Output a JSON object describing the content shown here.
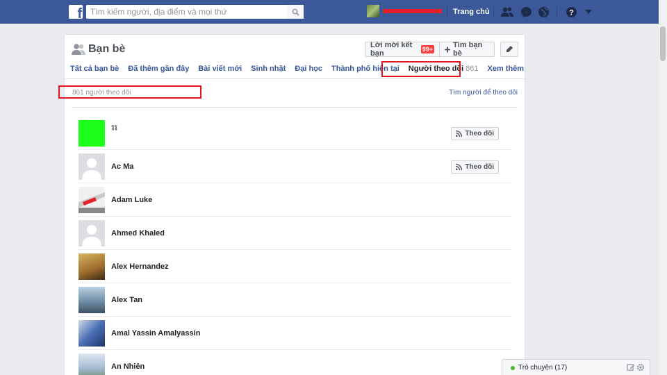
{
  "topbar": {
    "search_placeholder": "Tìm kiếm người, địa điểm và mọi thứ",
    "home_label": "Trang chủ",
    "icons": [
      "friend-requests-icon",
      "messenger-icon",
      "notifications-globe-icon",
      "help-icon",
      "dropdown-arrow-icon"
    ],
    "brand_color": "#3b5998"
  },
  "panel": {
    "title": "Bạn bè",
    "friend_requests_label": "Lời mời kết bạn",
    "friend_requests_badge": "99+",
    "find_friends_label": "Tìm bạn bè",
    "tabs": [
      {
        "label": "Tất cả bạn bè"
      },
      {
        "label": "Đã thêm gần đây"
      },
      {
        "label": "Bài viết mới"
      },
      {
        "label": "Sinh nhật"
      },
      {
        "label": "Đại học"
      },
      {
        "label": "Thành phố hiện tại"
      },
      {
        "label": "Người theo dõi",
        "count": "861"
      },
      {
        "label": "Xem thêm"
      }
    ],
    "follower_count_text": "861 người theo dõi",
    "find_followers_label": "Tìm người để theo dõi"
  },
  "followers": [
    {
      "name": "รูรู",
      "follow_label": "Theo dõi",
      "pic_color": "#1bff1b"
    },
    {
      "name": "Ac Ma",
      "follow_label": "Theo dõi",
      "pic_color": "#dcdee3"
    },
    {
      "name": "Adam Luke",
      "pic_color": "#f0f0f0"
    },
    {
      "name": "Ahmed Khaled",
      "pic_color": "#dcdee3"
    },
    {
      "name": "Alex Hernandez",
      "pic_color": "#b58a4a"
    },
    {
      "name": "Alex Tan",
      "pic_color": "#6f8ea8"
    },
    {
      "name": "Amal Yassin Amalyassin",
      "pic_color": "#4a6fb5"
    },
    {
      "name": "An Nhiên",
      "pic_color": "#9db6cf"
    }
  ],
  "chat": {
    "label": "Trò chuyện (17)",
    "status_color": "#42b72a"
  }
}
